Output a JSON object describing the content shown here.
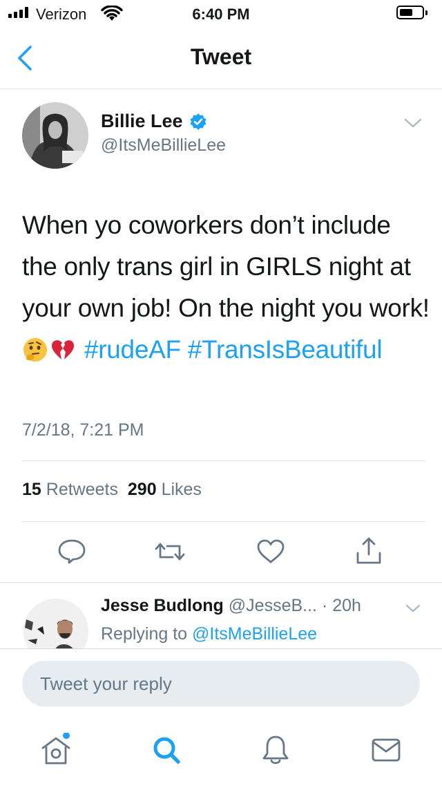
{
  "status_bar": {
    "carrier": "Verizon",
    "time": "6:40 PM"
  },
  "nav": {
    "title": "Tweet",
    "back_icon": "chevron-left-icon"
  },
  "tweet": {
    "author_name": "Billie Lee",
    "author_handle": "@ItsMeBillieLee",
    "text": "When yo coworkers don’t include the only trans girl in GIRLS night at your own job! On the night you work!",
    "emoji": [
      "thinking-face",
      "broken-heart"
    ],
    "hashtags": [
      "#rudeAF",
      "#TransIsBeautiful"
    ],
    "timestamp": "7/2/18, 7:21 PM",
    "retweets_count": "15",
    "retweets_label": "Retweets",
    "likes_count": "290",
    "likes_label": "Likes"
  },
  "reply": {
    "author_name": "Jesse Budlong",
    "author_handle": "@JesseB...",
    "time": "· 20h",
    "replying_prefix": "Replying to",
    "replying_to": "@ItsMeBillieLee"
  },
  "composer": {
    "placeholder": "Tweet your reply"
  },
  "tab_bar": [
    "home-icon",
    "search-icon",
    "notifications-icon",
    "messages-icon"
  ],
  "colors": {
    "accent": "#1da1f2",
    "secondary_text": "#657786",
    "divider": "#e1e8ed"
  }
}
